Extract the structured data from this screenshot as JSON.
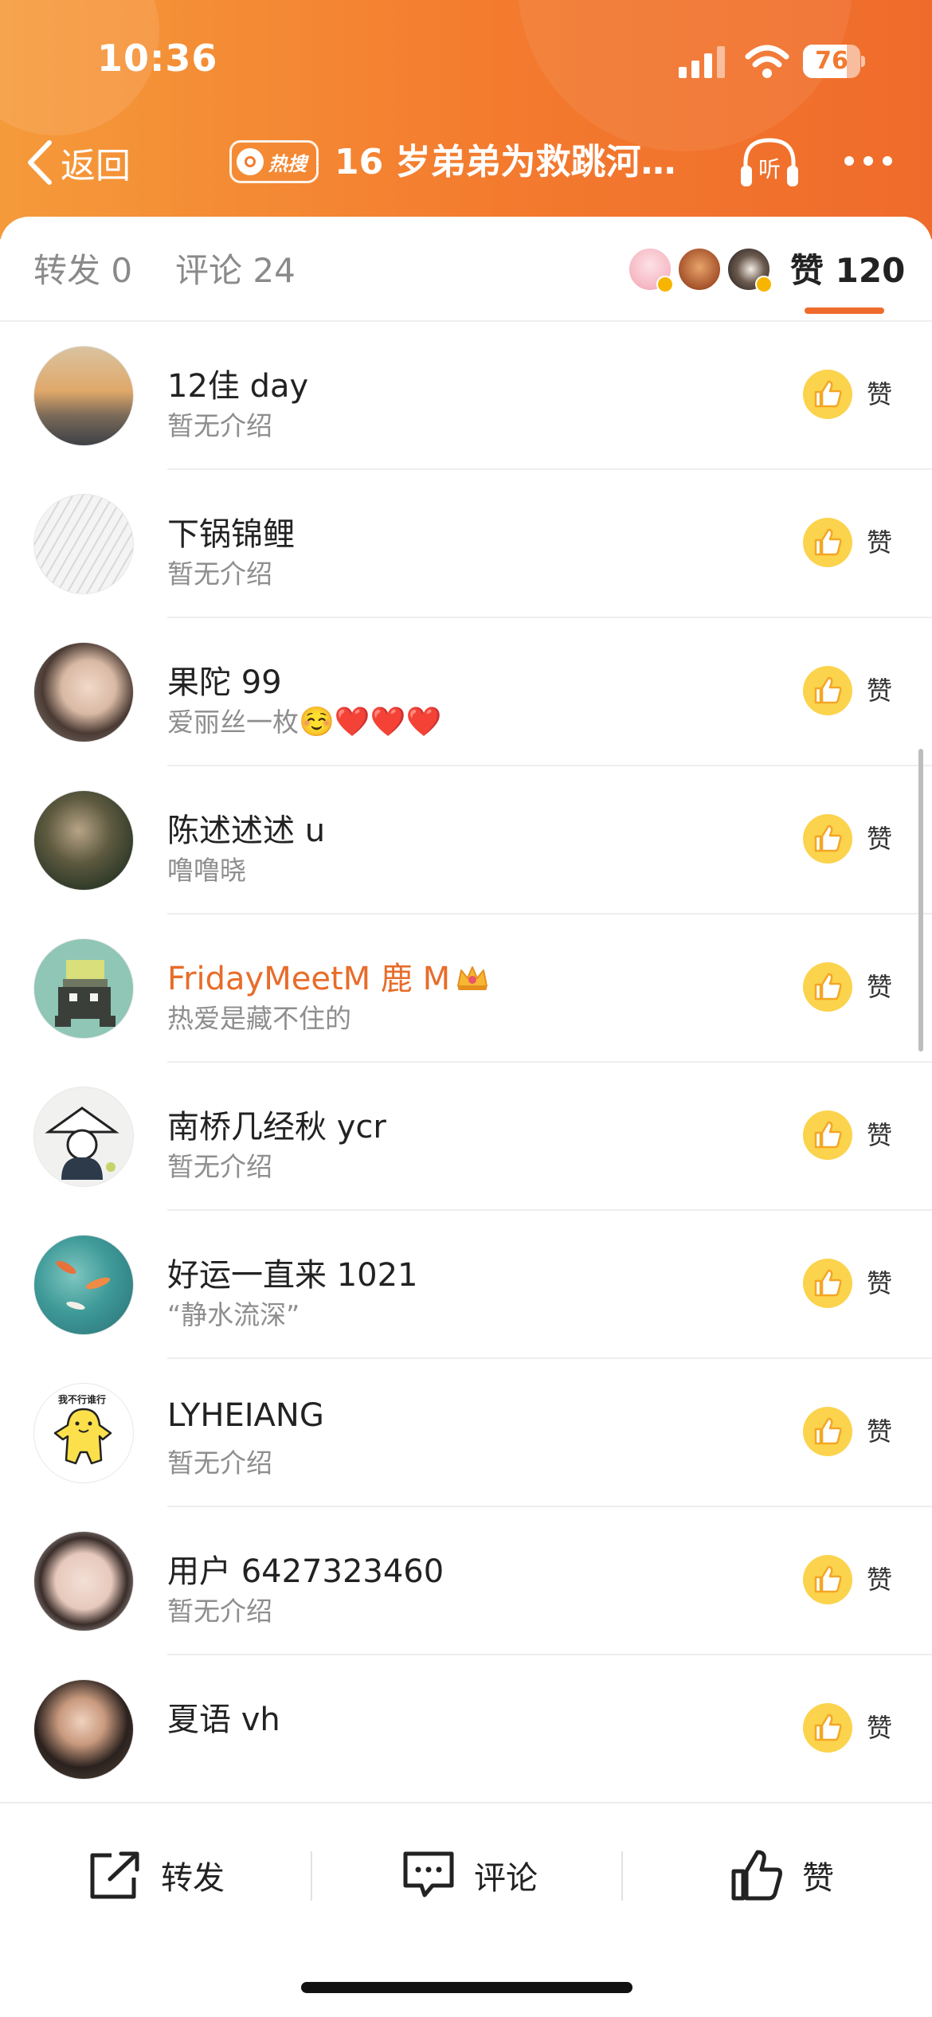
{
  "status_bar": {
    "time": "10:36",
    "battery": "76",
    "battery_level": 0.76
  },
  "nav": {
    "back_label": "返回",
    "hot_badge": "热搜",
    "title": "16 岁弟弟为救跳河…",
    "listen_label": "听"
  },
  "tabs": {
    "repost": "转发 0",
    "comment": "评论 24",
    "like": "赞 120"
  },
  "likers": [
    {
      "name": "12佳 day",
      "desc": "暂无介绍",
      "like": "赞"
    },
    {
      "name": "下锅锦鲤",
      "desc": "暂无介绍",
      "like": "赞"
    },
    {
      "name": "果陀 99",
      "desc": "爱丽丝一枚",
      "desc_emoji": "☺️❤️❤️❤️",
      "like": "赞"
    },
    {
      "name": "陈述述述 u",
      "desc": "噜噜晓",
      "like": "赞"
    },
    {
      "name": "FridayMeetM 鹿 M",
      "desc": "热爱是藏不住的",
      "like": "赞",
      "vip": true
    },
    {
      "name": "南桥几经秋 ycr",
      "desc": "暂无介绍",
      "like": "赞"
    },
    {
      "name": "好运一直来 1021",
      "desc": "“静水流深”",
      "like": "赞"
    },
    {
      "name": "LYHEIANG",
      "desc": "暂无介绍",
      "like": "赞",
      "avatar_text": "我不行谁行"
    },
    {
      "name": "用户 6427323460",
      "desc": "暂无介绍",
      "like": "赞"
    },
    {
      "name": "夏语 vh",
      "desc": "",
      "like": "赞"
    }
  ],
  "toolbar": {
    "repost": "转发",
    "comment": "评论",
    "like": "赞"
  },
  "colors": {
    "header_orange": "#f37a2e",
    "accent": "#ef6b2b",
    "vip_name": "#e86c2a",
    "like_yellow": "#fbd34c"
  }
}
